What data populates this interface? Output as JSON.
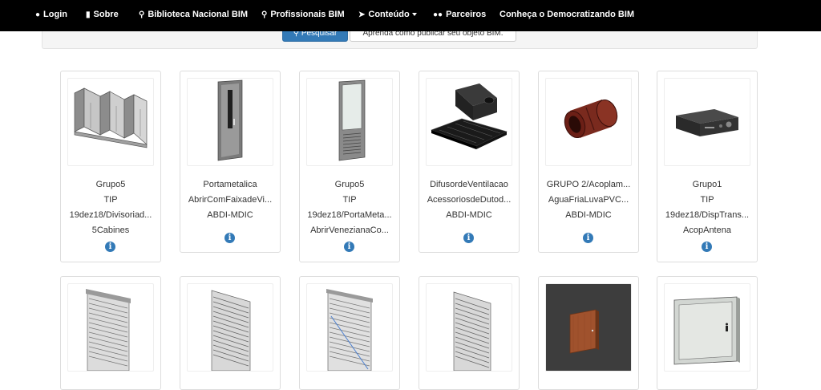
{
  "navbar": {
    "items": [
      {
        "label": "Login",
        "icon": "user-icon"
      },
      {
        "label": "Sobre",
        "icon": "book-icon"
      },
      {
        "label": "Biblioteca Nacional BIM",
        "icon": "search-icon"
      },
      {
        "label": "Profissionais BIM",
        "icon": "search-icon"
      },
      {
        "label": "Conteúdo",
        "icon": "paper-plane-icon"
      },
      {
        "label": "Parceiros",
        "icon": "users-icon"
      },
      {
        "label": "Conheça o Democratizando BIM"
      }
    ]
  },
  "search_bar": {
    "search_button_label": "Pesquisar",
    "publish_button_label": "Aprenda como publicar seu objeto BIM."
  },
  "cards": [
    {
      "lines": [
        "Grupo5",
        "TIP",
        "19dez18/Divisoriad...",
        "5Cabines"
      ],
      "image": "partition-cabins"
    },
    {
      "lines": [
        "Portametalica",
        "AbrirComFaixadeVi...",
        "ABDI-MDIC"
      ],
      "image": "metal-door"
    },
    {
      "lines": [
        "Grupo5",
        "TIP",
        "19dez18/PortaMeta...",
        "AbrirVenezianaCo..."
      ],
      "image": "louvered-door"
    },
    {
      "lines": [
        "DifusordeVentilacao",
        "AcessoriosdeDutod...",
        "ABDI-MDIC"
      ],
      "image": "ventilation-diffuser"
    },
    {
      "lines": [
        "GRUPO 2/Acoplam...",
        "AguaFriaLuvaPVC...",
        "ABDI-MDIC"
      ],
      "image": "pvc-coupling"
    },
    {
      "lines": [
        "Grupo1",
        "TIP",
        "19dez18/DispTrans...",
        "AcopAntena"
      ],
      "image": "antenna-device"
    },
    {
      "lines": [],
      "image": "rolling-shutter"
    },
    {
      "lines": [],
      "image": "rolling-shutter"
    },
    {
      "lines": [],
      "image": "rolling-shutter-blue"
    },
    {
      "lines": [],
      "image": "rolling-shutter"
    },
    {
      "lines": [],
      "image": "wood-panel-dark"
    },
    {
      "lines": [],
      "image": "inspection-panel"
    }
  ],
  "colors": {
    "navbar": "#000000",
    "primary": "#337ab7"
  }
}
